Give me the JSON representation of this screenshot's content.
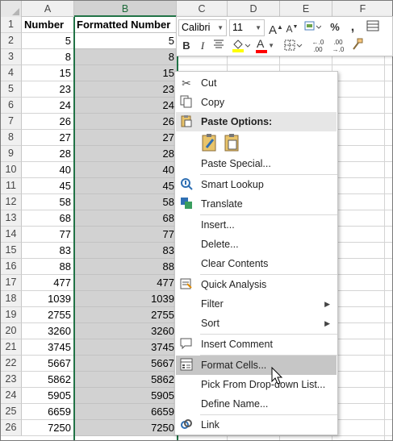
{
  "columns": [
    "A",
    "B",
    "C",
    "D",
    "E",
    "F"
  ],
  "header_row": {
    "a": "Number",
    "b": "Formatted Number"
  },
  "rows": [
    {
      "n": "1"
    },
    {
      "n": "2",
      "a": "5",
      "b": "5"
    },
    {
      "n": "3",
      "a": "8",
      "b": "8"
    },
    {
      "n": "4",
      "a": "15",
      "b": "15"
    },
    {
      "n": "5",
      "a": "23",
      "b": "23"
    },
    {
      "n": "6",
      "a": "24",
      "b": "24"
    },
    {
      "n": "7",
      "a": "26",
      "b": "26"
    },
    {
      "n": "8",
      "a": "27",
      "b": "27"
    },
    {
      "n": "9",
      "a": "28",
      "b": "28"
    },
    {
      "n": "10",
      "a": "40",
      "b": "40"
    },
    {
      "n": "11",
      "a": "45",
      "b": "45"
    },
    {
      "n": "12",
      "a": "58",
      "b": "58"
    },
    {
      "n": "13",
      "a": "68",
      "b": "68"
    },
    {
      "n": "14",
      "a": "77",
      "b": "77"
    },
    {
      "n": "15",
      "a": "83",
      "b": "83"
    },
    {
      "n": "16",
      "a": "88",
      "b": "88"
    },
    {
      "n": "17",
      "a": "477",
      "b": "477"
    },
    {
      "n": "18",
      "a": "1039",
      "b": "1039"
    },
    {
      "n": "19",
      "a": "2755",
      "b": "2755"
    },
    {
      "n": "20",
      "a": "3260",
      "b": "3260"
    },
    {
      "n": "21",
      "a": "3745",
      "b": "3745"
    },
    {
      "n": "22",
      "a": "5667",
      "b": "5667"
    },
    {
      "n": "23",
      "a": "5862",
      "b": "5862"
    },
    {
      "n": "24",
      "a": "5905",
      "b": "5905"
    },
    {
      "n": "25",
      "a": "6659",
      "b": "6659"
    },
    {
      "n": "26",
      "a": "7250",
      "b": "7250"
    }
  ],
  "mini_toolbar": {
    "font_name": "Calibri",
    "font_size": "11",
    "percent": "%",
    "comma": ",",
    "increase_decimal": "←.0\n.00",
    "decrease_decimal": ".00\n→.0",
    "bold": "B",
    "italic": "I",
    "grow_font": "A",
    "shrink_font": "A",
    "font_color": "A",
    "accent_fill": "#ffff00",
    "accent_font": "#ff0000"
  },
  "context_menu": {
    "cut": "Cut",
    "copy": "Copy",
    "paste_options": "Paste Options:",
    "paste_special": "Paste Special...",
    "smart_lookup": "Smart Lookup",
    "translate": "Translate",
    "insert": "Insert...",
    "delete": "Delete...",
    "clear_contents": "Clear Contents",
    "quick_analysis": "Quick Analysis",
    "filter": "Filter",
    "sort": "Sort",
    "insert_comment": "Insert Comment",
    "format_cells": "Format Cells...",
    "pick_list": "Pick From Drop-down List...",
    "define_name": "Define Name...",
    "link": "Link"
  },
  "colors": {
    "excel_green": "#217346",
    "selection": "#d2d2d2",
    "menu_highlight": "#c6c6c6"
  }
}
